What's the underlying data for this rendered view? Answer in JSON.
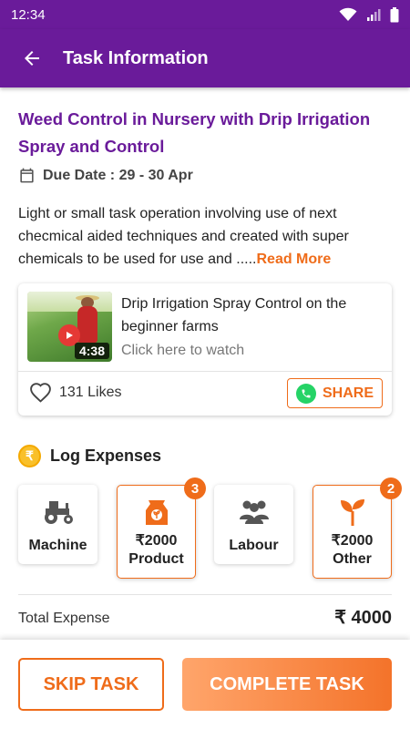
{
  "status_bar": {
    "time": "12:34",
    "icons": [
      "wifi-icon",
      "signal-icon",
      "battery-icon"
    ]
  },
  "app_bar": {
    "title": "Task Information",
    "back_icon": "arrow-left-icon"
  },
  "task": {
    "title": "Weed Control in Nursery with Drip Irrigation Spray and Control",
    "due_date": "Due Date : 29 - 30 Apr",
    "description": "Light or small task operation involving use of next checmical aided techniques and created with super chemicals to be used for use and .....",
    "read_more_label": "Read More"
  },
  "video": {
    "title": "Drip Irrigation Spray Control on the beginner farms",
    "watch_label": "Click here to watch",
    "duration": "4:38",
    "likes": "131 Likes",
    "share_label": "SHARE"
  },
  "expenses": {
    "header": "Log Expenses",
    "currency_symbol": "₹",
    "tiles": [
      {
        "label": "Machine",
        "amount": "",
        "badge": "",
        "icon": "tractor-icon"
      },
      {
        "label": "Product",
        "amount": "₹2000",
        "badge": "3",
        "icon": "fertilizer-bag-icon"
      },
      {
        "label": "Labour",
        "amount": "",
        "badge": "",
        "icon": "people-icon"
      },
      {
        "label": "Other",
        "amount": "₹2000",
        "badge": "2",
        "icon": "sprout-icon"
      }
    ],
    "total_label": "Total Expense",
    "total_value": "₹ 4000"
  },
  "actions": {
    "skip_label": "SKIP TASK",
    "complete_label": "COMPLETE TASK"
  },
  "colors": {
    "primary": "#6a1b9a",
    "accent": "#ef6c1a",
    "whatsapp": "#25d366"
  }
}
